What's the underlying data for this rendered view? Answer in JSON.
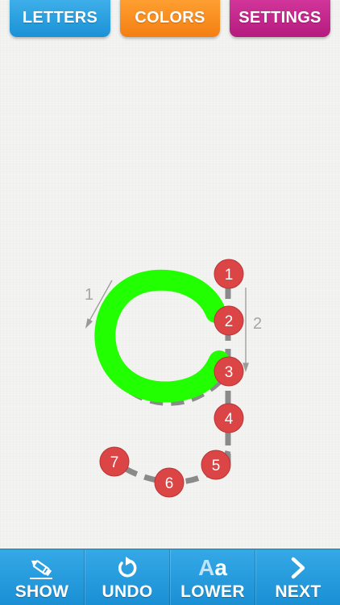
{
  "top_tabs": {
    "letters": "LETTERS",
    "colors": "COLORS",
    "settings": "SETTINGS"
  },
  "canvas": {
    "stroke_labels": [
      "1",
      "2"
    ],
    "dots": [
      "1",
      "2",
      "3",
      "4",
      "5",
      "6",
      "7"
    ],
    "trace_color": "#22ff00",
    "dot_color": "#e04848"
  },
  "bottom_bar": {
    "show": "SHOW",
    "undo": "UNDO",
    "lower": "LOWER",
    "next": "NEXT",
    "lower_icon_upper": "A",
    "lower_icon_lower": "a"
  },
  "icons": {
    "show": "pencil-icon",
    "undo": "undo-arrow-icon",
    "lower": "aa-case-icon",
    "next": "chevron-right-icon"
  }
}
